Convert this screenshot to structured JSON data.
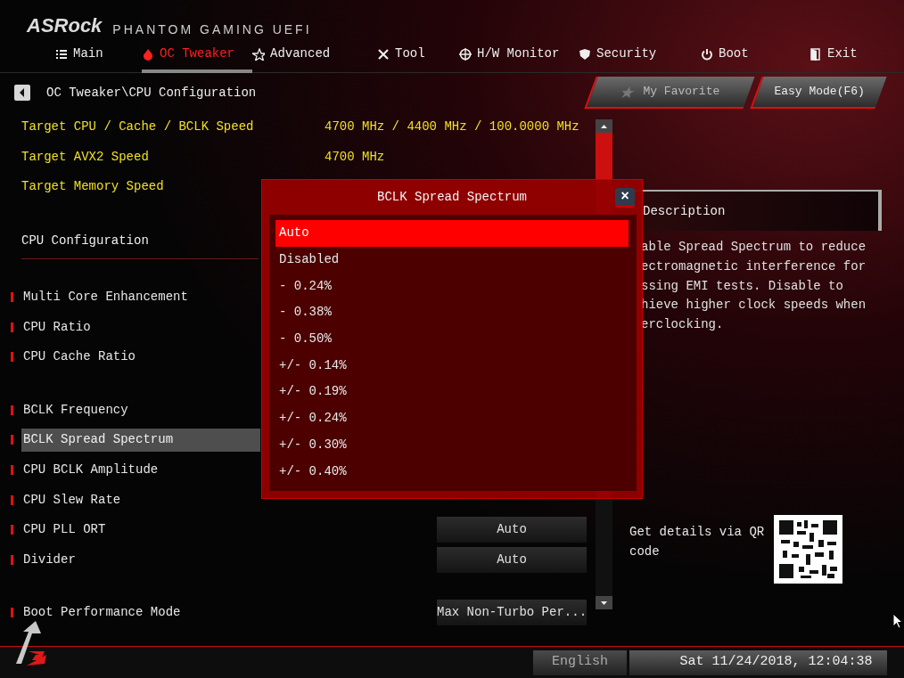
{
  "logo": {
    "brand": "ASRock",
    "product": "PHANTOM GAMING UEFI"
  },
  "tabs": [
    {
      "label": "Main",
      "selected": false
    },
    {
      "label": "OC Tweaker",
      "selected": true
    },
    {
      "label": "Advanced",
      "selected": false
    },
    {
      "label": "Tool",
      "selected": false
    },
    {
      "label": "H/W Monitor",
      "selected": false
    },
    {
      "label": "Security",
      "selected": false
    },
    {
      "label": "Boot",
      "selected": false
    },
    {
      "label": "Exit",
      "selected": false
    }
  ],
  "breadcrumb": "OC Tweaker\\CPU Configuration",
  "buttons": {
    "favorite": "My Favorite",
    "easy_mode": "Easy Mode(F6)"
  },
  "groups": [
    {
      "kind": "info",
      "items": [
        {
          "label": "Target CPU / Cache / BCLK Speed",
          "value": "4700 MHz / 4400 MHz / 100.0000 MHz"
        },
        {
          "label": "Target AVX2 Speed",
          "value": "4700 MHz"
        },
        {
          "label": "Target Memory Speed"
        }
      ]
    },
    {
      "kind": "heading",
      "items": [
        {
          "label": "CPU Configuration"
        }
      ]
    },
    {
      "kind": "settings",
      "items": [
        {
          "label": "Multi Core Enhancement",
          "selected": false
        },
        {
          "label": "CPU Ratio",
          "selected": false
        },
        {
          "label": "CPU Cache Ratio",
          "selected": false
        }
      ]
    },
    {
      "kind": "settings",
      "items": [
        {
          "label": "BCLK Frequency",
          "selected": false
        },
        {
          "label": "BCLK Spread Spectrum",
          "selected": true
        },
        {
          "label": "CPU BCLK Amplitude",
          "selected": false
        },
        {
          "label": "CPU Slew Rate",
          "selected": false
        },
        {
          "label": "CPU PLL ORT",
          "value": "Auto",
          "selected": false
        },
        {
          "label": "Divider",
          "value": "Auto",
          "selected": false
        }
      ]
    },
    {
      "kind": "settings",
      "items": [
        {
          "label": "Boot Performance Mode",
          "value": "Max Non-Turbo Per...",
          "selected": false
        }
      ]
    }
  ],
  "description": {
    "title": "Description",
    "lines": [
      "able Spread Spectrum to reduce",
      "ectromagnetic interference for",
      "ssing EMI tests. Disable to",
      "hieve higher clock speeds when",
      "erclocking."
    ]
  },
  "qr": {
    "text": "Get details via QR code"
  },
  "status_bar": {
    "language": "English",
    "datetime": "Sat 11/24/2018, 12:04:38"
  },
  "popup": {
    "title": "BCLK Spread Spectrum",
    "close": "×",
    "options": [
      {
        "label": "Auto",
        "selected": true
      },
      {
        "label": "Disabled",
        "selected": false
      },
      {
        "label": "- 0.24%",
        "selected": false
      },
      {
        "label": "- 0.38%",
        "selected": false
      },
      {
        "label": "- 0.50%",
        "selected": false
      },
      {
        "label": "+/- 0.14%",
        "selected": false
      },
      {
        "label": "+/- 0.19%",
        "selected": false
      },
      {
        "label": "+/- 0.24%",
        "selected": false
      },
      {
        "label": "+/- 0.30%",
        "selected": false
      },
      {
        "label": "+/- 0.40%",
        "selected": false
      }
    ]
  }
}
